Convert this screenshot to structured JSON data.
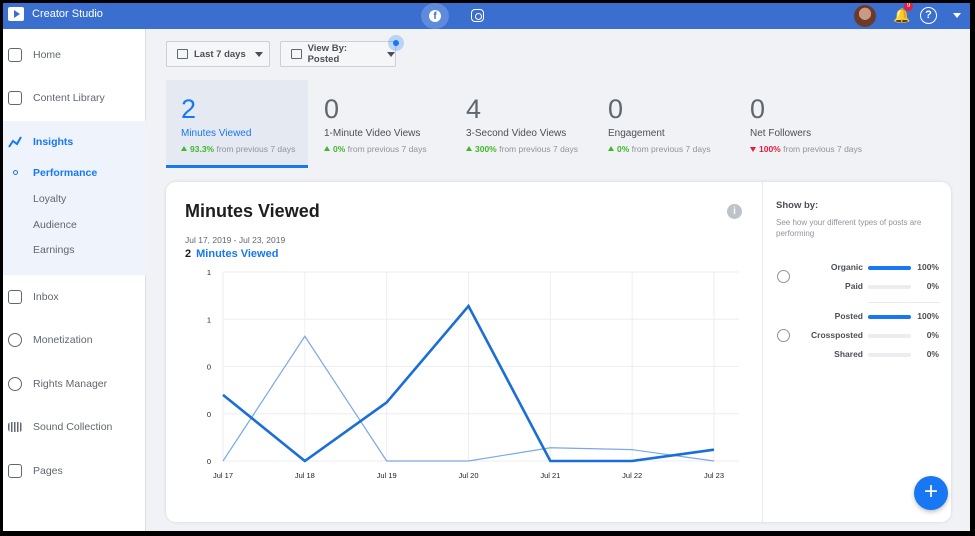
{
  "app": {
    "title": "Creator Studio"
  },
  "topbar": {
    "platforms": [
      "facebook-icon",
      "instagram-icon"
    ],
    "notification_count": "9"
  },
  "sidebar": {
    "items": [
      {
        "label": "Home",
        "icon": "home-icon"
      },
      {
        "label": "Content Library",
        "icon": "library-icon"
      },
      {
        "label": "Insights",
        "icon": "insights-icon"
      },
      {
        "label": "Inbox",
        "icon": "inbox-icon"
      },
      {
        "label": "Monetization",
        "icon": "dollar-icon"
      },
      {
        "label": "Rights Manager",
        "icon": "copyright-icon"
      },
      {
        "label": "Sound Collection",
        "icon": "sound-icon"
      },
      {
        "label": "Pages",
        "icon": "pages-icon"
      }
    ],
    "sub_items": [
      "Performance",
      "Loyalty",
      "Audience",
      "Earnings"
    ]
  },
  "filters": {
    "date": "Last 7 days",
    "view_by": "View By: Posted"
  },
  "metrics": [
    {
      "value": "2",
      "label": "Minutes Viewed",
      "change": "93.3%",
      "direction": "up",
      "suffix": "from previous 7 days"
    },
    {
      "value": "0",
      "label": "1-Minute Video Views",
      "change": "0%",
      "direction": "up",
      "suffix": "from previous 7 days"
    },
    {
      "value": "4",
      "label": "3-Second Video Views",
      "change": "300%",
      "direction": "up",
      "suffix": "from previous 7 days"
    },
    {
      "value": "0",
      "label": "Engagement",
      "change": "0%",
      "direction": "up",
      "suffix": "from previous 7 days"
    },
    {
      "value": "0",
      "label": "Net Followers",
      "change": "100%",
      "direction": "down",
      "suffix": "from previous 7 days"
    }
  ],
  "card": {
    "title": "Minutes Viewed",
    "date_range": "Jul 17, 2019 - Jul 23, 2019",
    "total": "2",
    "total_label": "Minutes Viewed"
  },
  "chart_data": {
    "type": "line",
    "categories": [
      "Jul 17",
      "Jul 18",
      "Jul 19",
      "Jul 20",
      "Jul 21",
      "Jul 22",
      "Jul 23"
    ],
    "y_tick_labels": [
      "1",
      "1",
      "0",
      "0",
      "0"
    ],
    "ylim": [
      0,
      1
    ],
    "grid": true,
    "series": [
      {
        "values": [
          0.35,
          0.0,
          0.31,
          0.82,
          0.0,
          0.0,
          0.06
        ],
        "color": "#1a6ed8"
      },
      {
        "values": [
          0.0,
          0.66,
          0.0,
          0.0,
          0.07,
          0.06,
          0.0
        ],
        "color": "#7aa8e8"
      }
    ]
  },
  "showby": {
    "title": "Show by:",
    "description": "See how your different types of posts are performing",
    "groups": [
      {
        "rows": [
          {
            "label": "Organic",
            "pct": "100%",
            "fill": 1.0
          },
          {
            "label": "Paid",
            "pct": "0%",
            "fill": 0.0
          }
        ]
      },
      {
        "rows": [
          {
            "label": "Posted",
            "pct": "100%",
            "fill": 1.0
          },
          {
            "label": "Crossposted",
            "pct": "0%",
            "fill": 0.0
          },
          {
            "label": "Shared",
            "pct": "0%",
            "fill": 0.0
          }
        ]
      }
    ]
  },
  "colors": {
    "brand": "#3a6fd0",
    "accent": "#1877f2",
    "up": "#42b72a",
    "down": "#e41e3f"
  }
}
